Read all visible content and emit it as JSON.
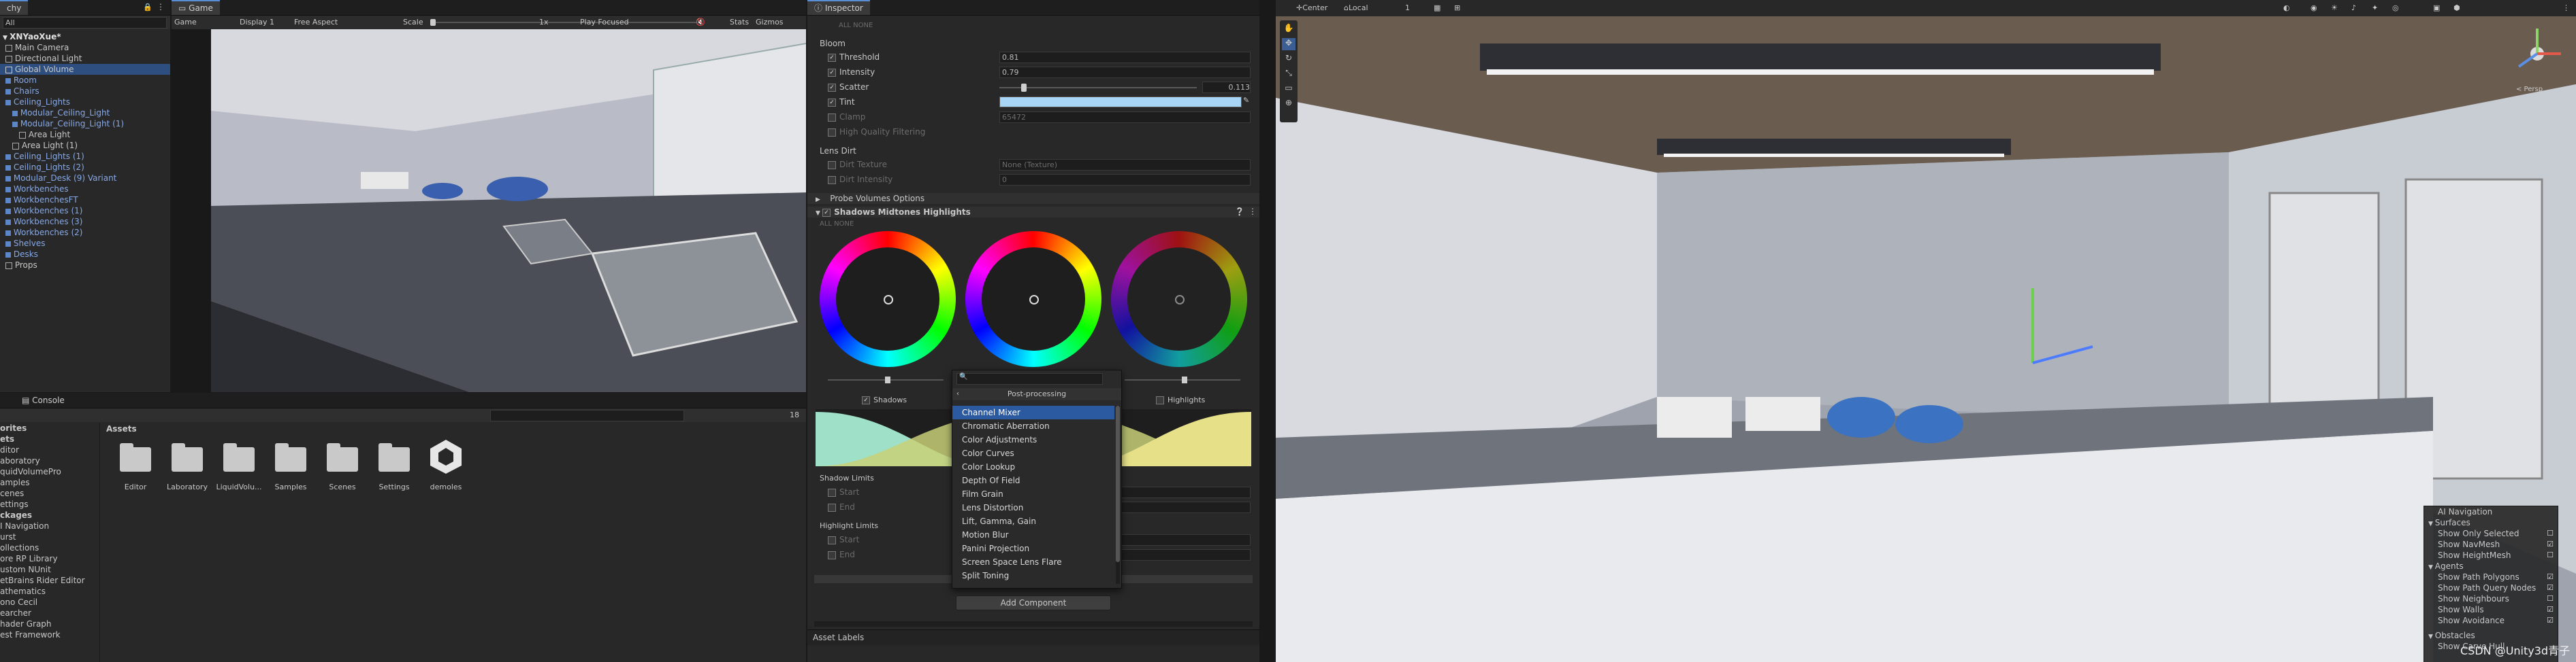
{
  "hierarchy": {
    "tab_partial": "chy",
    "search_value": "All",
    "items": [
      {
        "label": "XNYaoXue*",
        "style": "bold"
      },
      {
        "label": "Main Camera",
        "style": "normal"
      },
      {
        "label": "Directional Light",
        "style": "normal"
      },
      {
        "label": "Global Volume",
        "style": "selected"
      },
      {
        "label": "Room",
        "style": "blue"
      },
      {
        "label": "Chairs",
        "style": "blue"
      },
      {
        "label": "Ceiling_Lights",
        "style": "blue"
      },
      {
        "label": "Modular_Ceiling_Light",
        "style": "blue"
      },
      {
        "label": "Modular_Ceiling_Light (1)",
        "style": "blue"
      },
      {
        "label": "Area Light",
        "style": "normal"
      },
      {
        "label": "Area Light (1)",
        "style": "normal"
      },
      {
        "label": "Ceiling_Lights (1)",
        "style": "blue"
      },
      {
        "label": "Ceiling_Lights (2)",
        "style": "blue"
      },
      {
        "label": "Modular_Desk (9) Variant",
        "style": "blue"
      },
      {
        "label": "Workbenches",
        "style": "blue"
      },
      {
        "label": "WorkbenchesFT",
        "style": "blue"
      },
      {
        "label": "Workbenches (1)",
        "style": "blue"
      },
      {
        "label": "Workbenches (3)",
        "style": "blue"
      },
      {
        "label": "Workbenches (2)",
        "style": "blue"
      },
      {
        "label": "Shelves",
        "style": "blue"
      },
      {
        "label": "Desks",
        "style": "blue"
      },
      {
        "label": "Props",
        "style": "normal"
      }
    ]
  },
  "game": {
    "tab": "Game",
    "mode": "Game",
    "display": "Display 1",
    "aspect": "Free Aspect",
    "scale_label": "Scale",
    "scale_value": "1x",
    "play_focused": "Play Focused",
    "stats": "Stats",
    "gizmos": "Gizmos"
  },
  "project": {
    "tab_console": "Console",
    "breadcrumb": "Assets",
    "counter": "18",
    "sidebar": [
      "orites",
      "ets",
      "ditor",
      "aboratory",
      "quidVolumePro",
      "amples",
      "cenes",
      "ettings",
      "ckages",
      "I Navigation",
      "urst",
      "ollections",
      "ore RP Library",
      "ustom NUnit",
      "etBrains Rider Editor",
      "athematics",
      "ono Cecil",
      "earcher",
      "hader Graph",
      "est Framework"
    ],
    "assets": [
      "Editor",
      "Laboratory",
      "LiquidVolu...",
      "Samples",
      "Scenes",
      "Settings",
      "demoles"
    ]
  },
  "inspector": {
    "tab": "Inspector",
    "all_none": "ALL  NONE",
    "bloom_title": "Bloom",
    "threshold_label": "Threshold",
    "threshold_value": "0.81",
    "intensity_label": "Intensity",
    "intensity_value": "0.79",
    "scatter_label": "Scatter",
    "scatter_value": "0.113",
    "tint_label": "Tint",
    "clamp_label": "Clamp",
    "clamp_value": "65472",
    "hq_label": "High Quality Filtering",
    "lens_dirt_title": "Lens Dirt",
    "dirt_texture_label": "Dirt Texture",
    "dirt_texture_value": "None (Texture)",
    "dirt_intensity_label": "Dirt Intensity",
    "dirt_intensity_value": "0",
    "probe_title": "Probe Volumes Options",
    "smh_title": "Shadows Midtones Highlights",
    "shadows_label": "Shadows",
    "highlights_label": "Highlights",
    "shadow_limits": "Shadow Limits",
    "start_label": "Start",
    "end_label": "End",
    "highlight_limits": "Highlight Limits",
    "add_component": "Add Component",
    "asset_labels": "Asset Labels"
  },
  "popup": {
    "search_value": "",
    "title": "Post-processing",
    "items": [
      "Channel Mixer",
      "Chromatic Aberration",
      "Color Adjustments",
      "Color Curves",
      "Color Lookup",
      "Depth Of Field",
      "Film Grain",
      "Lens Distortion",
      "Lift, Gamma, Gain",
      "Motion Blur",
      "Panini Projection",
      "Screen Space Lens Flare",
      "Split Toning"
    ],
    "highlighted_index": 0
  },
  "scene": {
    "pivot": "Center",
    "space": "Local",
    "grid_value": "1",
    "persp": "< Persp",
    "overlay_title": "AI Navigation",
    "surfaces": "Surfaces",
    "show_only_selected": "Show Only Selected",
    "show_navmesh": "Show NavMesh",
    "show_heightmesh": "Show HeightMesh",
    "agents": "Agents",
    "show_path_polygons": "Show Path Polygons",
    "show_path_query_nodes": "Show Path Query Nodes",
    "show_neighbours": "Show Neighbours",
    "show_walls": "Show Walls",
    "show_avoidance": "Show Avoidance",
    "obstacles": "Obstacles",
    "show_carve_hull": "Show Carve Hull",
    "watermark": "CSDN @Unity3d青子"
  },
  "colors": {
    "accent": "#5a8fd6",
    "tint": "#a8d4f5",
    "hierarchy_blue": "#86a9e8",
    "selection": "#2c5aa0"
  }
}
